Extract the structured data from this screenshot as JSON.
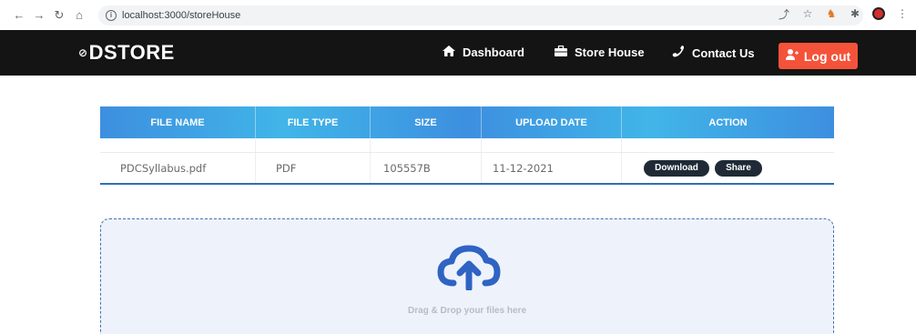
{
  "browser": {
    "url": "localhost:3000/storeHouse"
  },
  "header": {
    "brand": "DSTORE",
    "nav": {
      "dashboard": "Dashboard",
      "store_house": "Store House",
      "contact": "Contact Us"
    },
    "logout": "Log out"
  },
  "table": {
    "headers": [
      "FILE NAME",
      "FILE TYPE",
      "SIZE",
      "UPLOAD DATE",
      "ACTION"
    ],
    "rows": [
      {
        "file_name": "PDCSyllabus.pdf",
        "file_type": "PDF",
        "size": "105557B",
        "upload_date": "11-12-2021",
        "download": "Download",
        "share": "Share"
      }
    ]
  },
  "dropzone": {
    "text": "Drag & Drop your files here",
    "icon": "cloud-upload-icon"
  },
  "colors": {
    "header_bg": "#141414",
    "logout_bg": "#f4533a",
    "table_header": "#3d8fdf",
    "pill_bg": "#1f2a36",
    "dropzone_bg": "#eef3fb"
  }
}
